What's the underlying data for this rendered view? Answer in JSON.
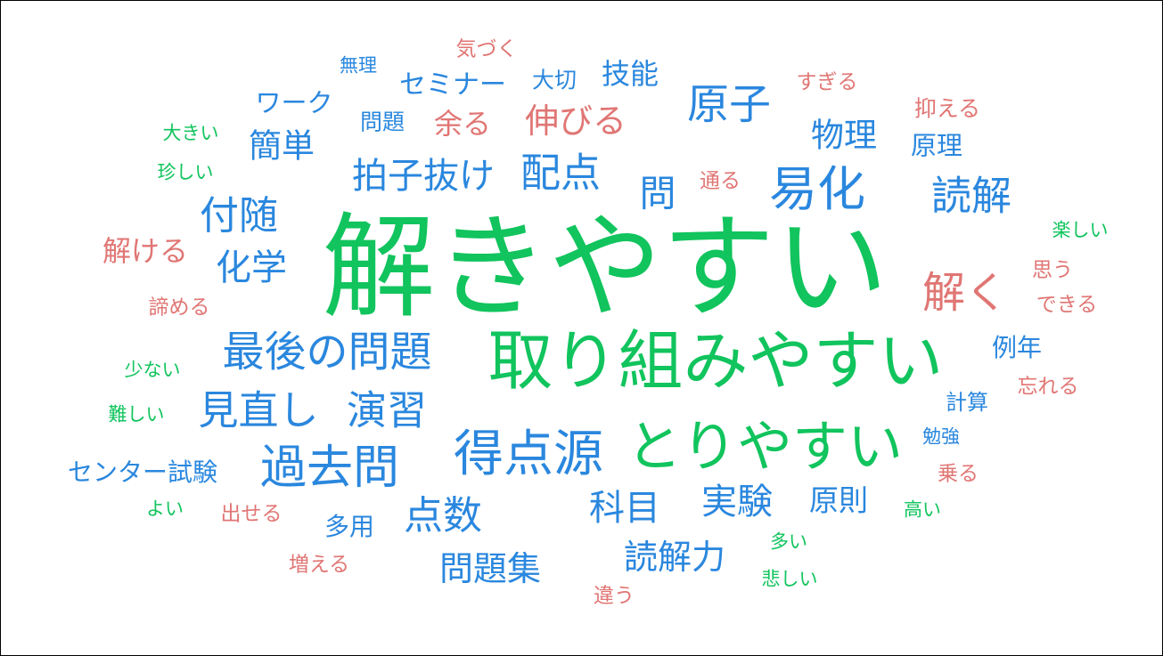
{
  "colors": {
    "green": "#11c45d",
    "blue": "#2a87de",
    "red": "#e07674"
  },
  "words": [
    {
      "text": "解きやすい",
      "color": "green",
      "weight": 100
    },
    {
      "text": "取り組みやすい",
      "color": "green",
      "weight": 58
    },
    {
      "text": "とりやすい",
      "color": "green",
      "weight": 48
    },
    {
      "text": "易化",
      "color": "blue",
      "weight": 46
    },
    {
      "text": "得点源",
      "color": "blue",
      "weight": 45
    },
    {
      "text": "過去問",
      "color": "blue",
      "weight": 42
    },
    {
      "text": "最後の問題",
      "color": "blue",
      "weight": 40
    },
    {
      "text": "原子",
      "color": "blue",
      "weight": 40
    },
    {
      "text": "解く",
      "color": "red",
      "weight": 40
    },
    {
      "text": "見直し",
      "color": "blue",
      "weight": 39
    },
    {
      "text": "演習",
      "color": "blue",
      "weight": 39
    },
    {
      "text": "配点",
      "color": "blue",
      "weight": 38
    },
    {
      "text": "読解",
      "color": "blue",
      "weight": 38
    },
    {
      "text": "付随",
      "color": "blue",
      "weight": 37
    },
    {
      "text": "点数",
      "color": "blue",
      "weight": 37
    },
    {
      "text": "拍子抜け",
      "color": "blue",
      "weight": 35
    },
    {
      "text": "問",
      "color": "blue",
      "weight": 35
    },
    {
      "text": "化学",
      "color": "blue",
      "weight": 34
    },
    {
      "text": "実験",
      "color": "blue",
      "weight": 34
    },
    {
      "text": "科目",
      "color": "blue",
      "weight": 34
    },
    {
      "text": "伸びる",
      "color": "red",
      "weight": 33
    },
    {
      "text": "問題集",
      "color": "blue",
      "weight": 33
    },
    {
      "text": "読解力",
      "color": "blue",
      "weight": 33
    },
    {
      "text": "簡単",
      "color": "blue",
      "weight": 32
    },
    {
      "text": "物理",
      "color": "blue",
      "weight": 32
    },
    {
      "text": "解ける",
      "color": "red",
      "weight": 29
    },
    {
      "text": "原則",
      "color": "blue",
      "weight": 29
    },
    {
      "text": "技能",
      "color": "blue",
      "weight": 28
    },
    {
      "text": "余る",
      "color": "red",
      "weight": 28
    },
    {
      "text": "セミナー",
      "color": "blue",
      "weight": 27
    },
    {
      "text": "ワーク",
      "color": "blue",
      "weight": 26
    },
    {
      "text": "原理",
      "color": "blue",
      "weight": 26
    },
    {
      "text": "センター試験",
      "color": "blue",
      "weight": 26
    },
    {
      "text": "例年",
      "color": "blue",
      "weight": 25
    },
    {
      "text": "多用",
      "color": "blue",
      "weight": 25
    },
    {
      "text": "問題",
      "color": "blue",
      "weight": 24
    },
    {
      "text": "大切",
      "color": "blue",
      "weight": 23
    },
    {
      "text": "抑える",
      "color": "red",
      "weight": 23
    },
    {
      "text": "諦める",
      "color": "red",
      "weight": 22
    },
    {
      "text": "すぎる",
      "color": "red",
      "weight": 22
    },
    {
      "text": "通る",
      "color": "red",
      "weight": 22
    },
    {
      "text": "計算",
      "color": "blue",
      "weight": 22
    },
    {
      "text": "出せる",
      "color": "red",
      "weight": 22
    },
    {
      "text": "気づく",
      "color": "red",
      "weight": 22
    },
    {
      "text": "増える",
      "color": "red",
      "weight": 22
    },
    {
      "text": "思う",
      "color": "red",
      "weight": 22
    },
    {
      "text": "できる",
      "color": "red",
      "weight": 22
    },
    {
      "text": "忘れる",
      "color": "red",
      "weight": 22
    },
    {
      "text": "乗る",
      "color": "red",
      "weight": 22
    },
    {
      "text": "違う",
      "color": "red",
      "weight": 22
    },
    {
      "text": "無理",
      "color": "blue",
      "weight": 21
    },
    {
      "text": "勉強",
      "color": "blue",
      "weight": 21
    },
    {
      "text": "大きい",
      "color": "green",
      "weight": 21
    },
    {
      "text": "珍しい",
      "color": "green",
      "weight": 21
    },
    {
      "text": "楽しい",
      "color": "green",
      "weight": 21
    },
    {
      "text": "少ない",
      "color": "green",
      "weight": 21
    },
    {
      "text": "難しい",
      "color": "green",
      "weight": 21
    },
    {
      "text": "よい",
      "color": "green",
      "weight": 21
    },
    {
      "text": "高い",
      "color": "green",
      "weight": 21
    },
    {
      "text": "多い",
      "color": "green",
      "weight": 21
    },
    {
      "text": "悲しい",
      "color": "green",
      "weight": 21
    }
  ]
}
